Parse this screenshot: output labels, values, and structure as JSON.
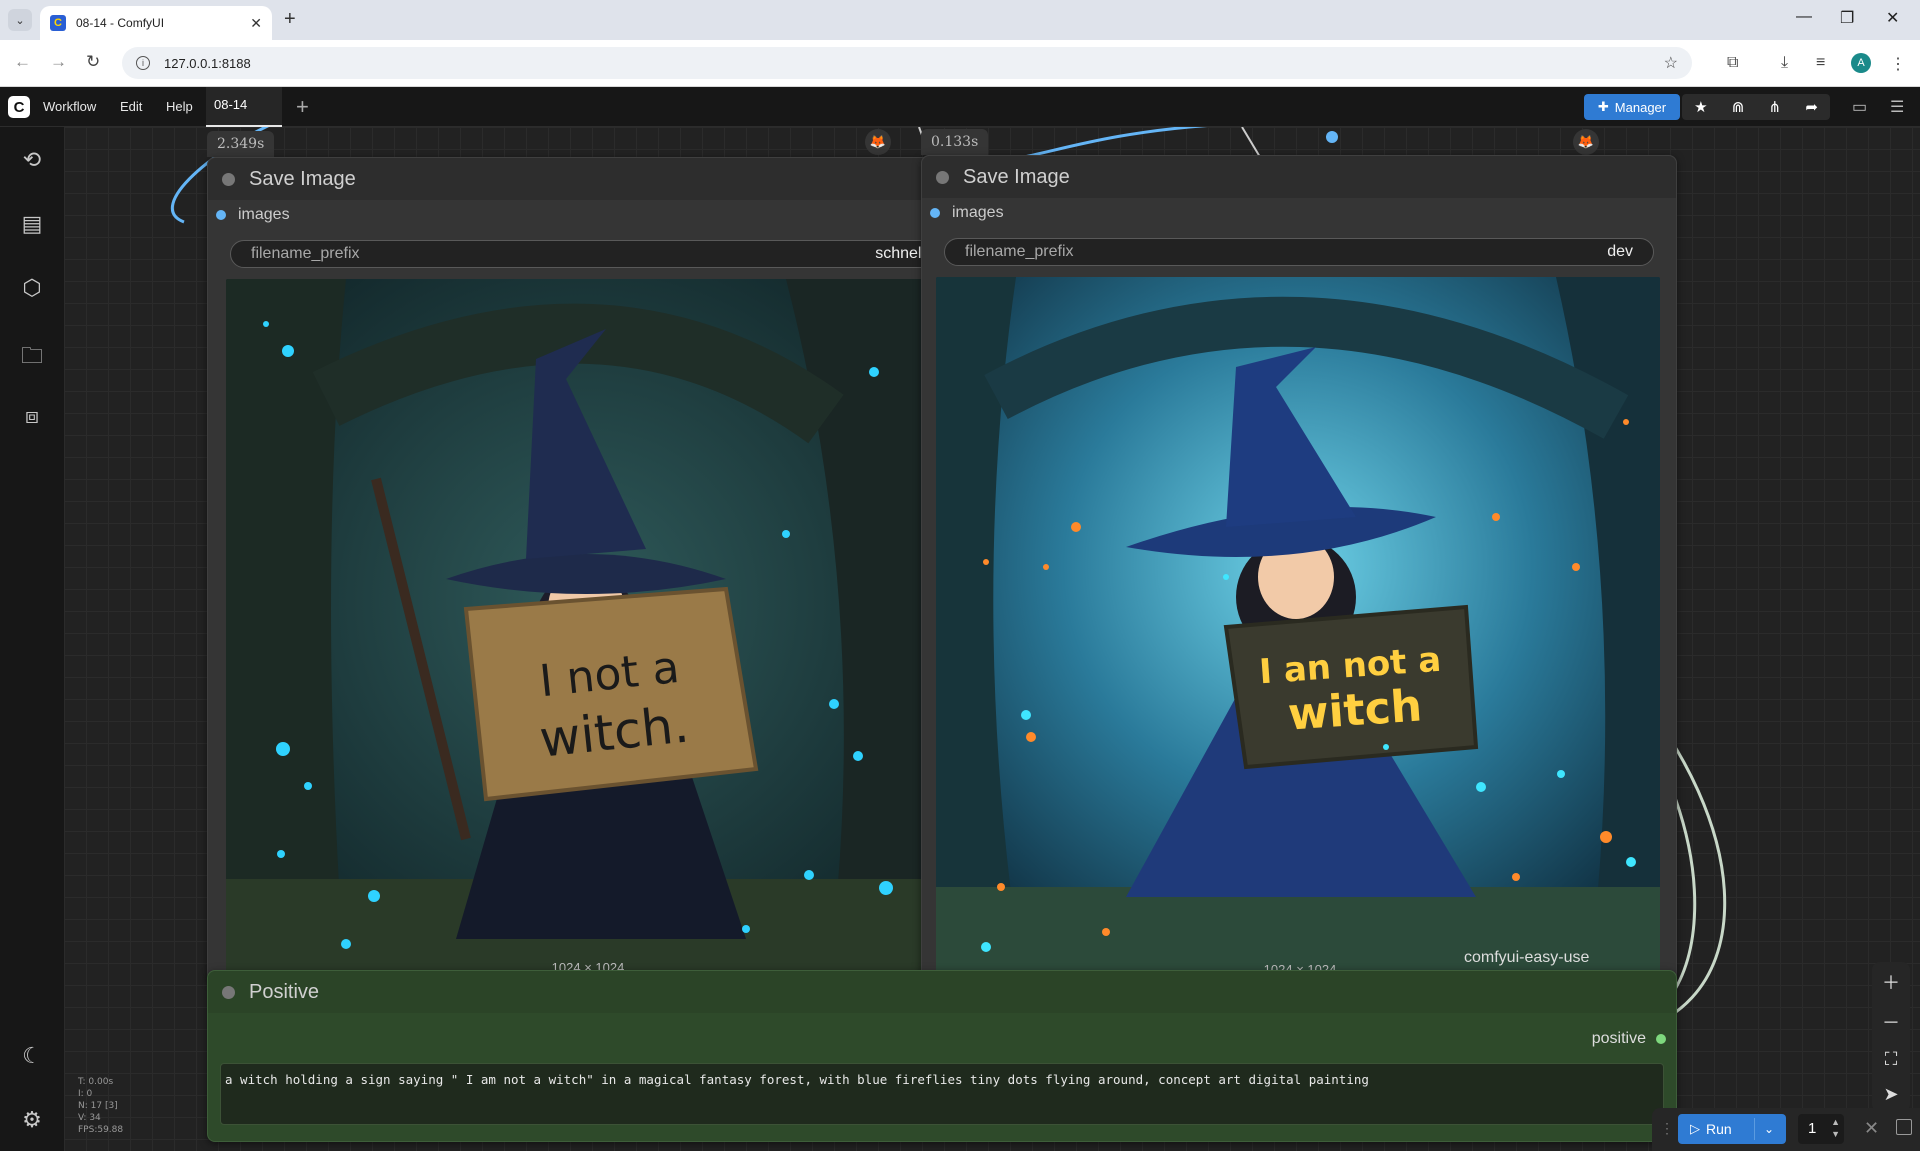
{
  "browser": {
    "tab_title": "08-14 - ComfyUI",
    "url": "127.0.0.1:8188",
    "profile_initial": "A"
  },
  "menu": {
    "items": [
      "Workflow",
      "Edit",
      "Help"
    ],
    "workflow_tab": "08-14",
    "manager_label": "Manager"
  },
  "nodes": {
    "save_left": {
      "timing": "2.349s",
      "title": "Save Image",
      "input_label": "images",
      "widget_name": "filename_prefix",
      "widget_value": "schnell",
      "image_size": "1024 × 1024",
      "sign_text_line1": "I not a",
      "sign_text_line2": "witch."
    },
    "save_right": {
      "timing": "0.133s",
      "title": "Save Image",
      "input_label": "images",
      "widget_name": "filename_prefix",
      "widget_value": "dev",
      "image_size": "1024 × 1024",
      "sign_text_line1": "I an not a",
      "sign_text_line2": "witch"
    },
    "hidden_node_label": "comfyui-easy-use",
    "positive": {
      "title": "Positive",
      "output_label": "positive",
      "prompt_text": "a witch holding a sign saying \" I am not a witch\" in a magical fantasy forest, with blue fireflies tiny dots flying around, concept art digital painting"
    }
  },
  "stats": {
    "t": "T: 0.00s",
    "i": "I: 0",
    "n": "N: 17 [3]",
    "v": "V: 34",
    "fps": "FPS:59.88"
  },
  "runbar": {
    "run_label": "Run",
    "batch_count": "1"
  },
  "colors": {
    "accent": "#2f7bd3",
    "link_blue": "#64b5f6",
    "positive_node": "#2e4a2a"
  }
}
